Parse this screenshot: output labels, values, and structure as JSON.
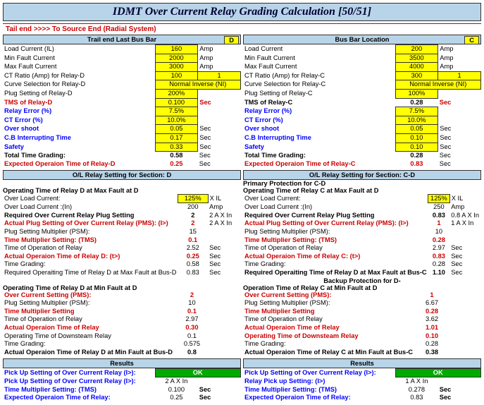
{
  "title": "IDMT Over Current Relay Grading Calculation [50/51]",
  "sub": "Tail end >>>> To Source End (Radial System)",
  "L": {
    "h1": "Trail end Last Bus Bar",
    "tag": "D",
    "p": [
      {
        "l": "Load Current (IL)",
        "v": "160",
        "u": "Amp",
        "y": 1
      },
      {
        "l": "Min Fault Current",
        "v": "2000",
        "u": "Amp",
        "y": 1
      },
      {
        "l": "Max Fault Current",
        "v": "3000",
        "u": "Amp",
        "y": 1
      },
      {
        "l": "CT Ratio (Amp) for Relay-D",
        "v": "100",
        "v2": "1",
        "y": 1
      },
      {
        "l": "Curve Selection for Relay-D",
        "v": "Normal Inverse (NI)",
        "y": 1,
        "w": 1
      },
      {
        "l": "Plug Setting of Relay-D",
        "v": "200%",
        "y": 1
      },
      {
        "l": "TMS of Relay-D",
        "v": "0.100",
        "u": "Sec",
        "y": 1,
        "red": 1,
        "ru": 1
      },
      {
        "l": "Relay Error (%)",
        "v": "7.5%",
        "y": 1,
        "bl": 1
      },
      {
        "l": "CT Error (%)",
        "v": "10.0%",
        "y": 1,
        "bl": 1
      },
      {
        "l": "Over shoot",
        "v": "0.05",
        "u": "Sec",
        "y": 1,
        "bl": 1
      },
      {
        "l": "C.B Interrupting Time",
        "v": "0.17",
        "u": "Sec",
        "y": 1,
        "bl": 1
      },
      {
        "l": "Safety",
        "v": "0.33",
        "u": "Sec",
        "y": 1,
        "bl": 1
      },
      {
        "l": "Total Time Grading:",
        "v": "0.58",
        "u": "Sec",
        "b": 1
      },
      {
        "l": "Expected Operaion Time of Relay-D",
        "v": "0.25",
        "u": "Sec",
        "b": 1,
        "red": 1
      }
    ],
    "h2": "O/L Relay Setting for Section:  D",
    "mx": "Operating Time of Relay D at Max Fault at D",
    "s1": [
      {
        "l": "Over Load Current:",
        "v": "125%",
        "u": "X IL",
        "y": 1
      },
      {
        "l": "Over Load Current :(In)",
        "v": "200",
        "u": "Amp"
      },
      {
        "l": "Required Over Current Relay Plug Setting",
        "v": "2",
        "u": "2 A X In",
        "b": 1
      },
      {
        "l": "Actual Plug Setting of Over Current Relay (PMS): (I>)",
        "v": "2",
        "u": "2 A X In",
        "red": 1,
        "b": 1
      },
      {
        "l": "Plug Setting Multiplier (PSM):",
        "v": "15"
      },
      {
        "l": "Time Multiplier Setting: (TMS)",
        "v": "0.1",
        "red": 1
      },
      {
        "l": "Time of Operation of Relay",
        "v": "2.52",
        "u": "Sec"
      },
      {
        "l": "Actual Operaion Time of Relay D: (t>)",
        "v": "0.25",
        "u": "Sec",
        "red": 1,
        "b": 1
      },
      {
        "l": "Time Grading:",
        "v": "0.58",
        "u": "Sec"
      },
      {
        "l": "Required Operaiting Time of Relay D at Max Fault at Bus-D",
        "v": "0.83",
        "u": "Sec"
      }
    ],
    "mn": "Operating Time of Relay D at Min Fault at D",
    "s2": [
      {
        "l": "Over Current Setting (PMS):",
        "v": "2",
        "red": 1
      },
      {
        "l": "Plug Setting Multiplier (PSM):",
        "v": "10"
      },
      {
        "l": "Time Multiplier Setting",
        "v": "0.1",
        "red": 1
      },
      {
        "l": "Time of Operation of Relay",
        "v": "2.97"
      },
      {
        "l": "Actual Operaion Time of Relay",
        "v": "0.30",
        "red": 1,
        "b": 1
      },
      {
        "l": "Operating Time of Downsteam Relay",
        "v": "0.1"
      },
      {
        "l": "Time Grading:",
        "v": "0.575"
      },
      {
        "l": "Actual Operaion Time of Relay D at Min Fault at Bus-D",
        "v": "0.8",
        "b": 1
      }
    ],
    "h3": "Results",
    "r": [
      {
        "l": "Pick Up Setting of Over Current Relay (I>):",
        "v": "OK",
        "ok": 1
      },
      {
        "l": "Pick Up Setting of Over Current Relay (I>):",
        "v": "2 A X In",
        "u": ""
      },
      {
        "l": "Time Multiplier Setting: (TMS)",
        "v": "0.100",
        "u": "Sec"
      },
      {
        "l": "Expected Operaion Time of Relay:",
        "v": "0.25",
        "u": "Sec"
      }
    ]
  },
  "R": {
    "h1": "Bus Bar Location",
    "tag": "C",
    "p": [
      {
        "l": "Load Current",
        "v": "200",
        "u": "Amp",
        "y": 1
      },
      {
        "l": "Min Fault Current",
        "v": "3500",
        "u": "Amp",
        "y": 1
      },
      {
        "l": "Max Fault Current",
        "v": "4000",
        "u": "Amp",
        "y": 1
      },
      {
        "l": "CT Ratio (Amp) for Relay-C",
        "v": "300",
        "v2": "1",
        "y": 1
      },
      {
        "l": "Curve Selection for Relay-C",
        "v": "Normal Inverse (NI)",
        "y": 1,
        "w": 1
      },
      {
        "l": "Plug Setting of Relay-C",
        "v": "100%",
        "y": 1
      },
      {
        "l": "TMS of Relay-C",
        "v": "0.28",
        "u": "Sec",
        "b": 1,
        "ru": 1
      },
      {
        "l": "Relay Error (%)",
        "v": "7.5%",
        "y": 1,
        "bl": 1
      },
      {
        "l": "CT Error (%)",
        "v": "10.0%",
        "y": 1,
        "bl": 1
      },
      {
        "l": "Over shoot",
        "v": "0.05",
        "u": "Sec",
        "y": 1,
        "bl": 1
      },
      {
        "l": "C.B Interrupting Time",
        "v": "0.10",
        "u": "Sec",
        "y": 1,
        "bl": 1
      },
      {
        "l": "Safety",
        "v": "0.10",
        "u": "Sec",
        "y": 1,
        "bl": 1
      },
      {
        "l": "Total Time Grading:",
        "v": "0.28",
        "u": "Sec",
        "b": 1
      },
      {
        "l": "Expected Operaion Time of Relay-C",
        "v": "0.83",
        "u": "Sec",
        "b": 1,
        "red": 1
      }
    ],
    "h2": "O/L Relay Setting for Section:  C-D",
    "pp": "Primary Protection for C-D",
    "mx": "Operating Time of Relay C at Max Fault at D",
    "s1": [
      {
        "l": "Over Load Current:",
        "v": "125%",
        "u": "X IL",
        "y": 1
      },
      {
        "l": "Over Load Current :(In)",
        "v": "250",
        "u": "Amp"
      },
      {
        "l": "Required Over Current Relay Plug Setting",
        "v": "0.83",
        "u": "0.8 A X In",
        "b": 1
      },
      {
        "l": "Actual Plug Setting of Over Current Relay (PMS): (I>)",
        "v": "1",
        "u": "1 A X In",
        "red": 1,
        "b": 1
      },
      {
        "l": "Plug Setting Multiplier (PSM):",
        "v": "10"
      },
      {
        "l": "Time Multiplier Setting: (TMS)",
        "v": "0.28",
        "red": 1
      },
      {
        "l": "Time of Operation of Relay",
        "v": "2.97",
        "u": "Sec"
      },
      {
        "l": "Actual Operaion Time of Relay C: (t>)",
        "v": "0.83",
        "u": "Sec",
        "red": 1,
        "b": 1
      },
      {
        "l": "Time Grading:",
        "v": "0.28",
        "u": "Sec"
      },
      {
        "l": "Required Operaiting Time of Relay D at Max Fault at Bus-C",
        "v": "1.10",
        "u": "Sec",
        "b": 1
      }
    ],
    "bk": "Backup Protection for D-",
    "mn": "Operation Time of Relay C at Min Fault at D",
    "s2": [
      {
        "l": "Over Current Setting (PMS):",
        "v": "1",
        "red": 1
      },
      {
        "l": "Plug Setting Multiplier (PSM):",
        "v": "6.67"
      },
      {
        "l": "Time Multiplier Setting",
        "v": "0.28",
        "red": 1
      },
      {
        "l": "Time of Operation of Relay",
        "v": "3.62"
      },
      {
        "l": "Actual Operaion Time of Relay",
        "v": "1.01",
        "red": 1,
        "b": 1
      },
      {
        "l": "Operating Time of Downsteam Relay",
        "v": "0.10",
        "red": 1
      },
      {
        "l": "Time Grading:",
        "v": "0.28"
      },
      {
        "l": "Actual Operaion Time of Relay C at Min Fault at Bus-C",
        "v": "0.38",
        "b": 1
      }
    ],
    "h3": "Results",
    "r": [
      {
        "l": "Pick Up Setting of Over Current Relay (I>):",
        "v": "OK",
        "ok": 1
      },
      {
        "l": "Relay Pick up Setting: (I>)",
        "v": "1 A X In",
        "u": ""
      },
      {
        "l": "Time Multiplier Setting: (TMS)",
        "v": "0.278",
        "u": "Sec"
      },
      {
        "l": "Expected Operaion Time of Relay:",
        "v": "0.83",
        "u": "Sec"
      }
    ]
  }
}
